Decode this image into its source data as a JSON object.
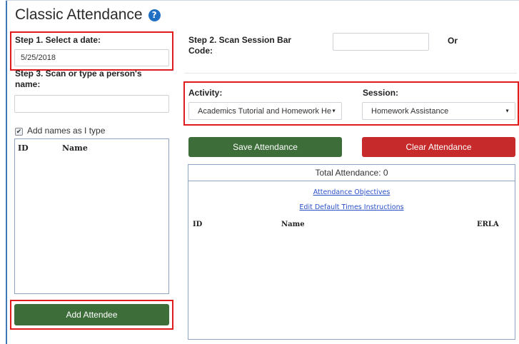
{
  "page": {
    "title": "Classic Attendance",
    "help_icon": "question-circle-icon"
  },
  "step1": {
    "label": "Step 1. Select a date:",
    "date_value": "5/25/2018"
  },
  "step2": {
    "label": "Step 2. Scan Session Bar Code:",
    "barcode_value": "",
    "or_label": "Or"
  },
  "step3": {
    "label": "Step 3. Scan or type a person's name:",
    "name_value": ""
  },
  "activity": {
    "label": "Activity:",
    "selected": "Academics Tutorial and Homework He"
  },
  "session": {
    "label": "Session:",
    "selected": "Homework Assistance"
  },
  "add_names": {
    "checked": true,
    "label": "Add names as I type"
  },
  "names_list": {
    "columns": [
      "ID",
      "Name"
    ],
    "rows": []
  },
  "buttons": {
    "add_attendee": "Add Attendee",
    "save_attendance": "Save Attendance",
    "clear_attendance": "Clear Attendance"
  },
  "attendance_panel": {
    "total": "Total Attendance: 0",
    "link_objectives": "Attendance Objectives",
    "link_default_times": "Edit Default Times Instructions",
    "columns": [
      "ID",
      "Name",
      "ERLA"
    ],
    "rows": []
  },
  "colors": {
    "highlight": "#e01b1b",
    "green_button": "#3d6e3a",
    "red_button": "#c62a2a",
    "link": "#2a50c8",
    "help_icon": "#1f6fc2"
  }
}
